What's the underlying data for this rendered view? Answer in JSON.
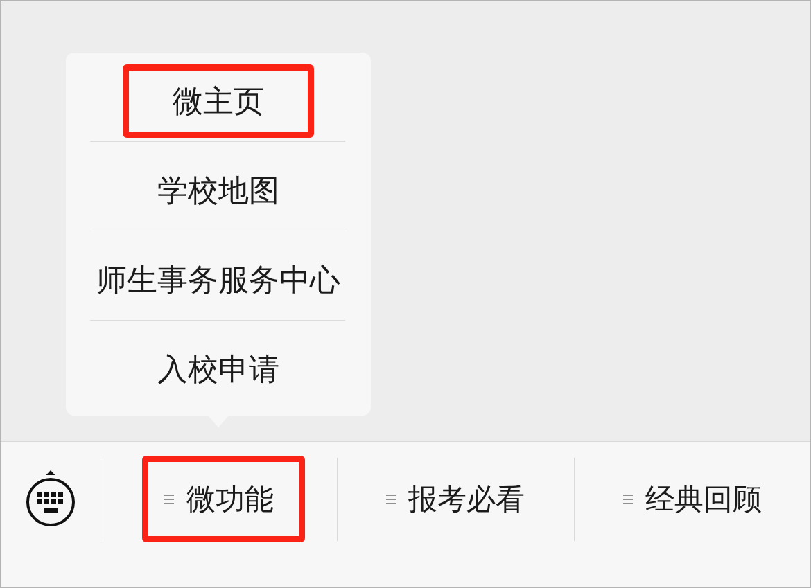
{
  "popup_menu": {
    "items": [
      {
        "label": "微主页",
        "highlighted": true
      },
      {
        "label": "学校地图",
        "highlighted": false
      },
      {
        "label": "师生事务服务中心",
        "highlighted": false
      },
      {
        "label": "入校申请",
        "highlighted": false
      }
    ]
  },
  "menu_bar": {
    "menus": [
      {
        "label": "微功能",
        "highlighted": true
      },
      {
        "label": "报考必看",
        "highlighted": false
      },
      {
        "label": "经典回顾",
        "highlighted": false
      }
    ]
  }
}
